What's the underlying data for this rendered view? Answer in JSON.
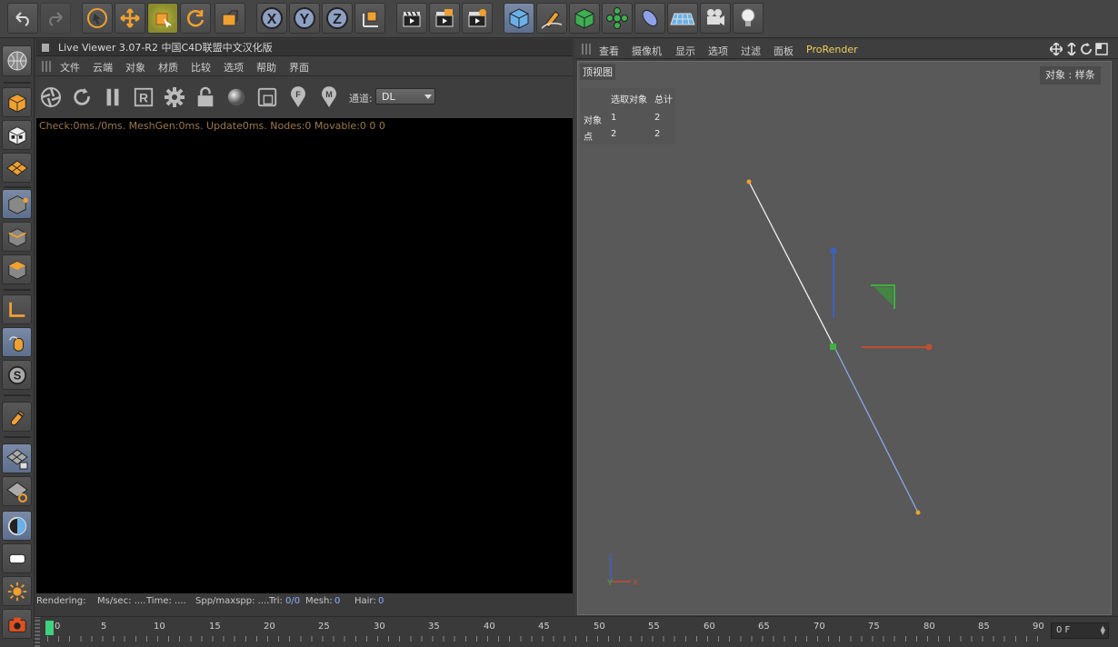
{
  "live_viewer": {
    "title": "Live Viewer 3.07-R2 中国C4D联盟中文汉化版",
    "menu": [
      "文件",
      "云端",
      "对象",
      "材质",
      "比较",
      "选项",
      "帮助",
      "界面"
    ],
    "channel_label": "通道:",
    "channel_value": "DL",
    "check_text": "Check:0ms./0ms. MeshGen:0ms. Update0ms. Nodes:0 Movable:0  0 0",
    "status": {
      "rendering": "Rendering:",
      "ms_sec": "Ms/sec: ....",
      "time": "Time: ....",
      "spp": "Spp/maxspp: ....",
      "tri_label": "Tri:",
      "tri_value": "0/0",
      "mesh_label": "Mesh:",
      "mesh_value": "0",
      "hair_label": "Hair:",
      "hair_value": "0"
    }
  },
  "viewport": {
    "menu": [
      "查看",
      "摄像机",
      "显示",
      "选项",
      "过滤",
      "面板"
    ],
    "prorender": "ProRender",
    "view_name": "顶视图",
    "object_label": "对象 : 样条",
    "stats": {
      "col_selected": "选取对象",
      "col_total": "总计",
      "row_objects": "对象",
      "objects_selected": "1",
      "objects_total": "2",
      "row_points": "点",
      "points_selected": "2",
      "points_total": "2"
    },
    "axis_z": "Z",
    "axis_y": "Y",
    "axis_x": "X"
  },
  "timeline": {
    "ticks": [
      "0",
      "5",
      "10",
      "15",
      "20",
      "25",
      "30",
      "35",
      "40",
      "45",
      "50",
      "55",
      "60",
      "65",
      "70",
      "75",
      "80",
      "85",
      "90"
    ],
    "frame_value": "0 F"
  },
  "colors": {
    "accent_orange": "#f0a030",
    "axis_blue": "#4060c0",
    "axis_red": "#c05030",
    "axis_green": "#40b040",
    "prorender_yellow": "#f0d060"
  }
}
